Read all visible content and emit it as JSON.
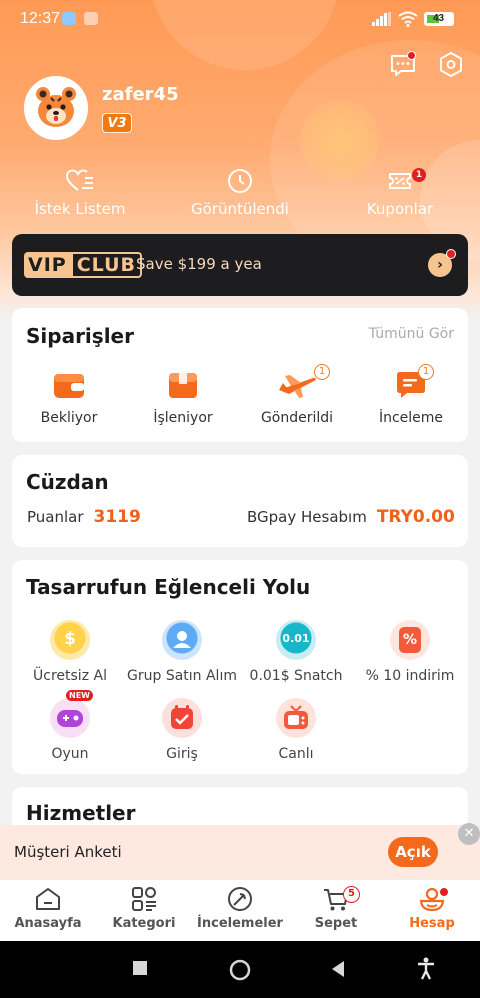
{
  "status_bar": {
    "time": "12:37",
    "battery": "43"
  },
  "header": {
    "username": "zafer45",
    "vip_level": "V3",
    "quick_links": [
      {
        "label": "İstek Listem",
        "icon": "heart-list-icon"
      },
      {
        "label": "Görüntülendi",
        "icon": "clock-icon"
      },
      {
        "label": "Kuponlar",
        "icon": "coupon-icon",
        "badge": "1"
      }
    ]
  },
  "vip_banner": {
    "logo_left": "VIP",
    "logo_right": "CLUB",
    "text": "Save $199 a yea",
    "arrow": "›"
  },
  "orders": {
    "title": "Siparişler",
    "see_all": "Tümünü Gör",
    "items": [
      {
        "label": "Bekliyor",
        "icon": "wallet-icon"
      },
      {
        "label": "İşleniyor",
        "icon": "box-icon"
      },
      {
        "label": "Gönderildi",
        "icon": "airplane-icon",
        "badge": "1"
      },
      {
        "label": "İnceleme",
        "icon": "review-icon",
        "badge": "1"
      }
    ]
  },
  "wallet": {
    "title": "Cüzdan",
    "points_label": "Puanlar",
    "points_value": "3119",
    "balance_label": "BGpay Hesabım",
    "balance_value": "TRY0.00"
  },
  "fun": {
    "title": "Tasarrufun Eğlenceli Yolu",
    "items": [
      {
        "label": "Ücretsiz Al",
        "icon": "dollar-coin-icon",
        "glyph": "$"
      },
      {
        "label": "Grup Satın Alım",
        "icon": "group-icon"
      },
      {
        "label": "0.01$ Snatch",
        "icon": "snatch-icon",
        "glyph": "0.01"
      },
      {
        "label": "% 10 indirim",
        "icon": "percent-icon",
        "glyph": "%"
      },
      {
        "label": "Oyun",
        "icon": "gamepad-icon",
        "tag": "NEW"
      },
      {
        "label": "Giriş",
        "icon": "calendar-check-icon"
      },
      {
        "label": "Canlı",
        "icon": "tv-icon"
      }
    ]
  },
  "services": {
    "title": "Hizmetler"
  },
  "survey": {
    "text": "Müşteri Anketi",
    "button": "Açık",
    "close": "✕"
  },
  "tabbar": {
    "tabs": [
      {
        "label": "Anasayfa",
        "icon": "home-icon"
      },
      {
        "label": "Kategori",
        "icon": "category-icon"
      },
      {
        "label": "İncelemeler",
        "icon": "reviews-icon"
      },
      {
        "label": "Sepet",
        "icon": "cart-icon",
        "count": "5"
      },
      {
        "label": "Hesap",
        "icon": "account-icon",
        "active": true
      }
    ]
  },
  "colors": {
    "accent": "#f36a1d",
    "vip_bg": "#1d1d1f",
    "vip_gold": "#f7c38f",
    "badge_red": "#e02020"
  }
}
